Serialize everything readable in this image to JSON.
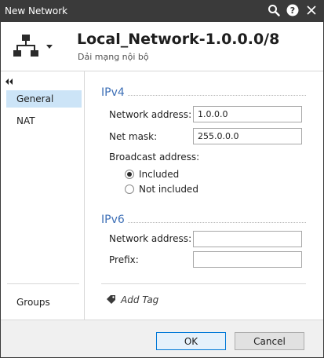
{
  "window": {
    "title": "New Network"
  },
  "header": {
    "object_name": "Local_Network-1.0.0.0/8",
    "comment": "Dải mạng nội bộ",
    "object_icon": "network-topology-icon"
  },
  "sidebar": {
    "items": [
      {
        "label": "General",
        "selected": true
      },
      {
        "label": "NAT",
        "selected": false
      }
    ],
    "bottom_items": [
      {
        "label": "Groups"
      }
    ]
  },
  "ipv4": {
    "title": "IPv4",
    "network_address_label": "Network address:",
    "network_address_value": "1.0.0.0",
    "net_mask_label": "Net mask:",
    "net_mask_value": "255.0.0.0",
    "broadcast_label": "Broadcast address:",
    "broadcast_options": [
      {
        "label": "Included",
        "checked": true
      },
      {
        "label": "Not included",
        "checked": false
      }
    ]
  },
  "ipv6": {
    "title": "IPv6",
    "network_address_label": "Network address:",
    "network_address_value": "",
    "prefix_label": "Prefix:",
    "prefix_value": ""
  },
  "tags": {
    "add_label": "Add Tag"
  },
  "footer": {
    "ok_label": "OK",
    "cancel_label": "Cancel"
  },
  "colors": {
    "titlebar": "#3a3a3a",
    "section_title": "#3d6fb6",
    "nav_selected": "#cce4f7",
    "ok_border": "#0078d7"
  }
}
